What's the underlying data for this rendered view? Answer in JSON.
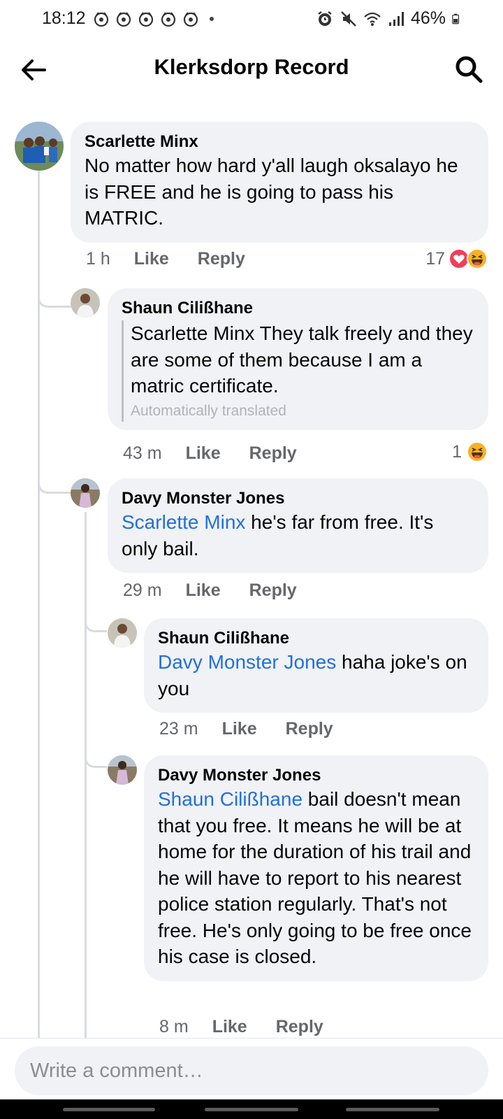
{
  "status_bar": {
    "time": "18:12",
    "battery": "46%",
    "icons": [
      "notification-icon",
      "alarm-icon",
      "mute-icon",
      "wifi-icon",
      "signal-icon",
      "battery-icon"
    ]
  },
  "header": {
    "title": "Klerksdorp Record",
    "back_icon": "arrow-left-icon",
    "search_icon": "search-icon"
  },
  "comments": [
    {
      "author": "Scarlette Minx",
      "text": "No matter how hard y'all laugh oksalayo he is FREE and he is going to pass his MATRIC.",
      "time": "1 h",
      "like": "Like",
      "reply": "Reply",
      "reaction_count": "17",
      "reaction_icons": [
        "love-icon",
        "haha-icon"
      ]
    },
    {
      "author": "Shaun Cilißhane",
      "text": "Scarlette Minx They talk freely and they are some of them because I am a matric certificate.",
      "translated_label": "Automatically translated",
      "time": "43 m",
      "like": "Like",
      "reply": "Reply",
      "reaction_count": "1",
      "reaction_icons": [
        "haha-icon"
      ]
    },
    {
      "author": "Davy Monster Jones",
      "mention": "Scarlette Minx",
      "text": " he's far from free. It's only bail.",
      "time": "29 m",
      "like": "Like",
      "reply": "Reply"
    },
    {
      "author": "Shaun Cilißhane",
      "mention": "Davy Monster Jones",
      "text": " haha joke's on you",
      "time": "23 m",
      "like": "Like",
      "reply": "Reply"
    },
    {
      "author": "Davy Monster Jones",
      "mention": "Shaun Cilißhane",
      "text": " bail doesn't mean that you free. It means he will be at home for the duration of his trail and he will have to report to his nearest police station regularly. That's not free. He's only going to be free once his case is closed.",
      "time": "8 m",
      "like": "Like",
      "reply": "Reply"
    }
  ],
  "composer": {
    "placeholder": "Write a comment…"
  },
  "colors": {
    "mention": "#216fdb",
    "bubble": "#f0f2f5",
    "meta": "#65676b",
    "love": "#f33e58",
    "haha": "#f7b125"
  }
}
